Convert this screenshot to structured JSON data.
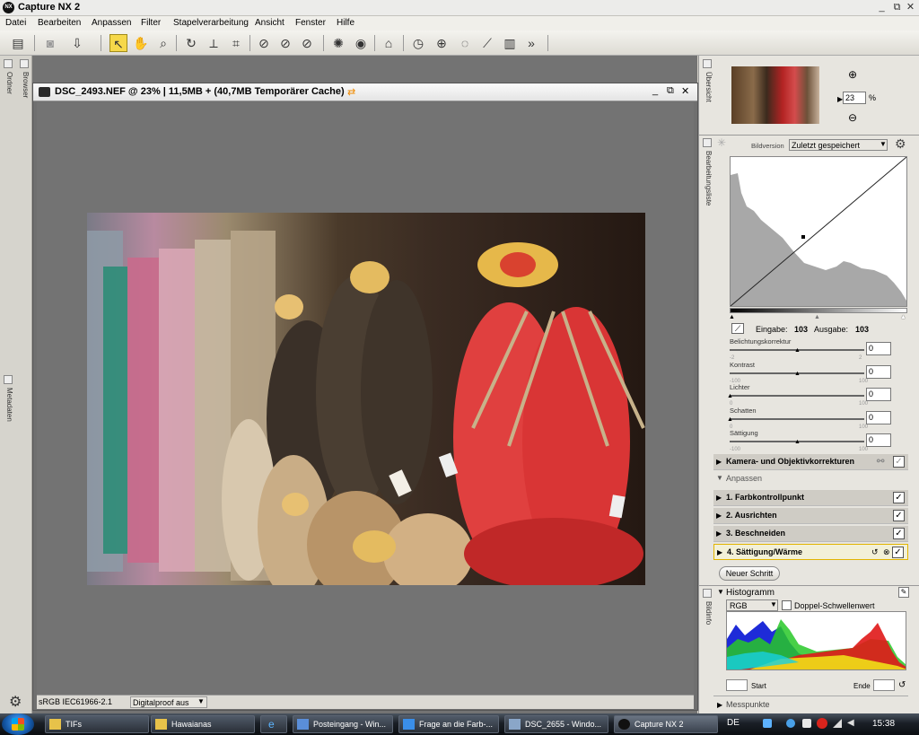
{
  "app": {
    "logo": "NX",
    "title": "Capture NX 2"
  },
  "window_controls": {
    "minimize": "_",
    "restore": "⧉",
    "close": "✕"
  },
  "menu": [
    "Datei",
    "Bearbeiten",
    "Anpassen",
    "Filter",
    "Stapelverarbeitung",
    "Ansicht",
    "Fenster",
    "Hilfe"
  ],
  "toolbar_icons": [
    "view-mode-icon",
    "camera-icon",
    "export-icon",
    "select-arrow-icon",
    "hand-icon",
    "zoom-icon",
    "rotate-icon",
    "straighten-icon",
    "crop-icon",
    "red-eye-icon",
    "red-eye-brush-icon",
    "red-eye-lasso-icon",
    "auto-retouch-icon",
    "quick-fix-icon",
    "tag-icon",
    "control-point-icon",
    "color-point-icon",
    "lasso-icon",
    "brush-icon",
    "gradient-icon",
    "more-icon"
  ],
  "left_panels": {
    "top": "Ordner",
    "browser": "Browser",
    "metadata": "Metadaten"
  },
  "document": {
    "title": "DSC_2493.NEF @ 23% | 11,5MB + (40,7MB Temporärer Cache)",
    "color_profile": "sRGB IEC61966-2.1",
    "proof": "Digitalproof aus"
  },
  "overview": {
    "label": "Übersicht",
    "zoom_value": "23",
    "zoom_unit": "%"
  },
  "edit_list": {
    "label": "Bearbeitungsliste",
    "bildversion_label": "Bildversion",
    "bildversion_value": "Zuletzt gespeichert",
    "input_label": "Eingabe:",
    "input_value": "103",
    "output_label": "Ausgabe:",
    "output_value": "103",
    "sliders": [
      {
        "label": "Belichtungskorrektur",
        "min": "-2",
        "max": "2",
        "value": "0",
        "pos": 0.5
      },
      {
        "label": "Kontrast",
        "min": "-100",
        "max": "100",
        "value": "0",
        "pos": 0.5
      },
      {
        "label": "Lichter",
        "min": "0",
        "max": "100",
        "value": "0",
        "pos": 0.0
      },
      {
        "label": "Schatten",
        "min": "0",
        "max": "100",
        "value": "0",
        "pos": 0.0
      },
      {
        "label": "Sättigung",
        "min": "-100",
        "max": "100",
        "value": "0",
        "pos": 0.5
      }
    ],
    "camera_row": "Kamera- und Objektivkorrekturen",
    "anpassen_header": "Anpassen",
    "steps": [
      {
        "label": "1. Farbkontrollpunkt",
        "checked": "✓"
      },
      {
        "label": "2. Ausrichten",
        "checked": "✓"
      },
      {
        "label": "3. Beschneiden",
        "checked": "✓"
      },
      {
        "label": "4. Sättigung/Wärme",
        "checked": "✓"
      }
    ],
    "new_step_button": "Neuer Schritt"
  },
  "histogram": {
    "side_label": "Bildinfo",
    "title": "Histogramm",
    "channel": "RGB",
    "dual_threshold_label": "Doppel-Schwellenwert",
    "start_label": "Start",
    "end_label": "Ende",
    "messpunkte": "Messpunkte"
  },
  "taskbar": {
    "tasks": [
      "TIFs",
      "Hawaianas",
      "Posteingang - Win...",
      "Frage an die Farb-...",
      "DSC_2655 - Windo...",
      "Capture NX 2"
    ],
    "language": "DE",
    "clock": "15:38"
  }
}
